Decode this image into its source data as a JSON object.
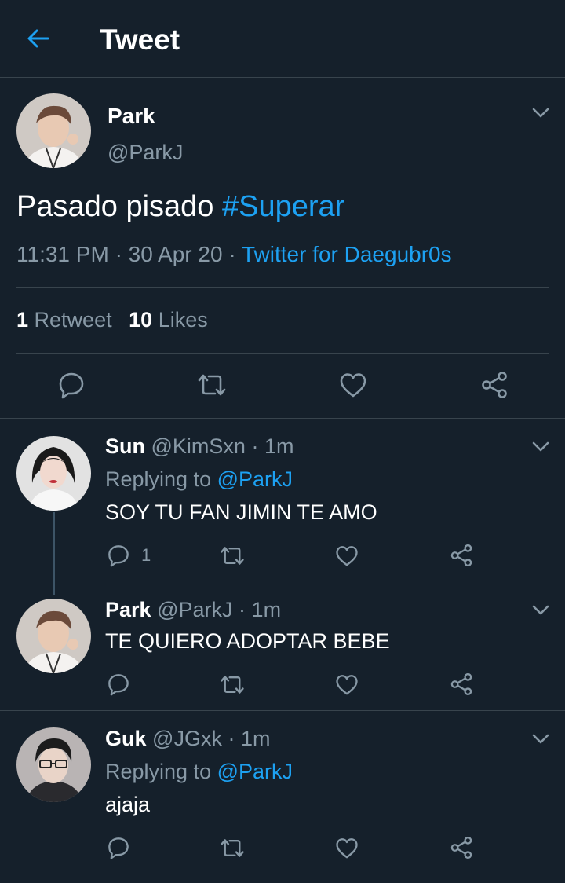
{
  "header": {
    "title": "Tweet"
  },
  "tweet": {
    "name": "Park",
    "handle": "@ParkJ",
    "text": "Pasado pisado",
    "hashtag": "#Superar",
    "time": "11:31 PM",
    "date": "30 Apr 20",
    "source": "Twitter for Daegubr0s",
    "retweets": "1",
    "retweets_label": "Retweet",
    "likes": "10",
    "likes_label": "Likes"
  },
  "replies": [
    {
      "name": "Sun",
      "handle": "@KimSxn",
      "time": "1m",
      "replying_prefix": "Replying to",
      "replying_to": "@ParkJ",
      "text": "SOY TU FAN JIMIN TE AMO",
      "reply_count": "1"
    },
    {
      "name": "Park",
      "handle": "@ParkJ",
      "time": "1m",
      "text": "TE QUIERO ADOPTAR BEBE"
    },
    {
      "name": "Guk",
      "handle": "@JGxk",
      "time": "1m",
      "replying_prefix": "Replying to",
      "replying_to": "@ParkJ",
      "text": "ajaja"
    }
  ],
  "colors": {
    "background": "#15202b",
    "accent": "#1da1f2",
    "muted": "#8899a6",
    "divider": "#38444d"
  },
  "icons": [
    "back-arrow-icon",
    "chevron-down-icon",
    "reply-icon",
    "retweet-icon",
    "like-icon",
    "share-icon"
  ]
}
